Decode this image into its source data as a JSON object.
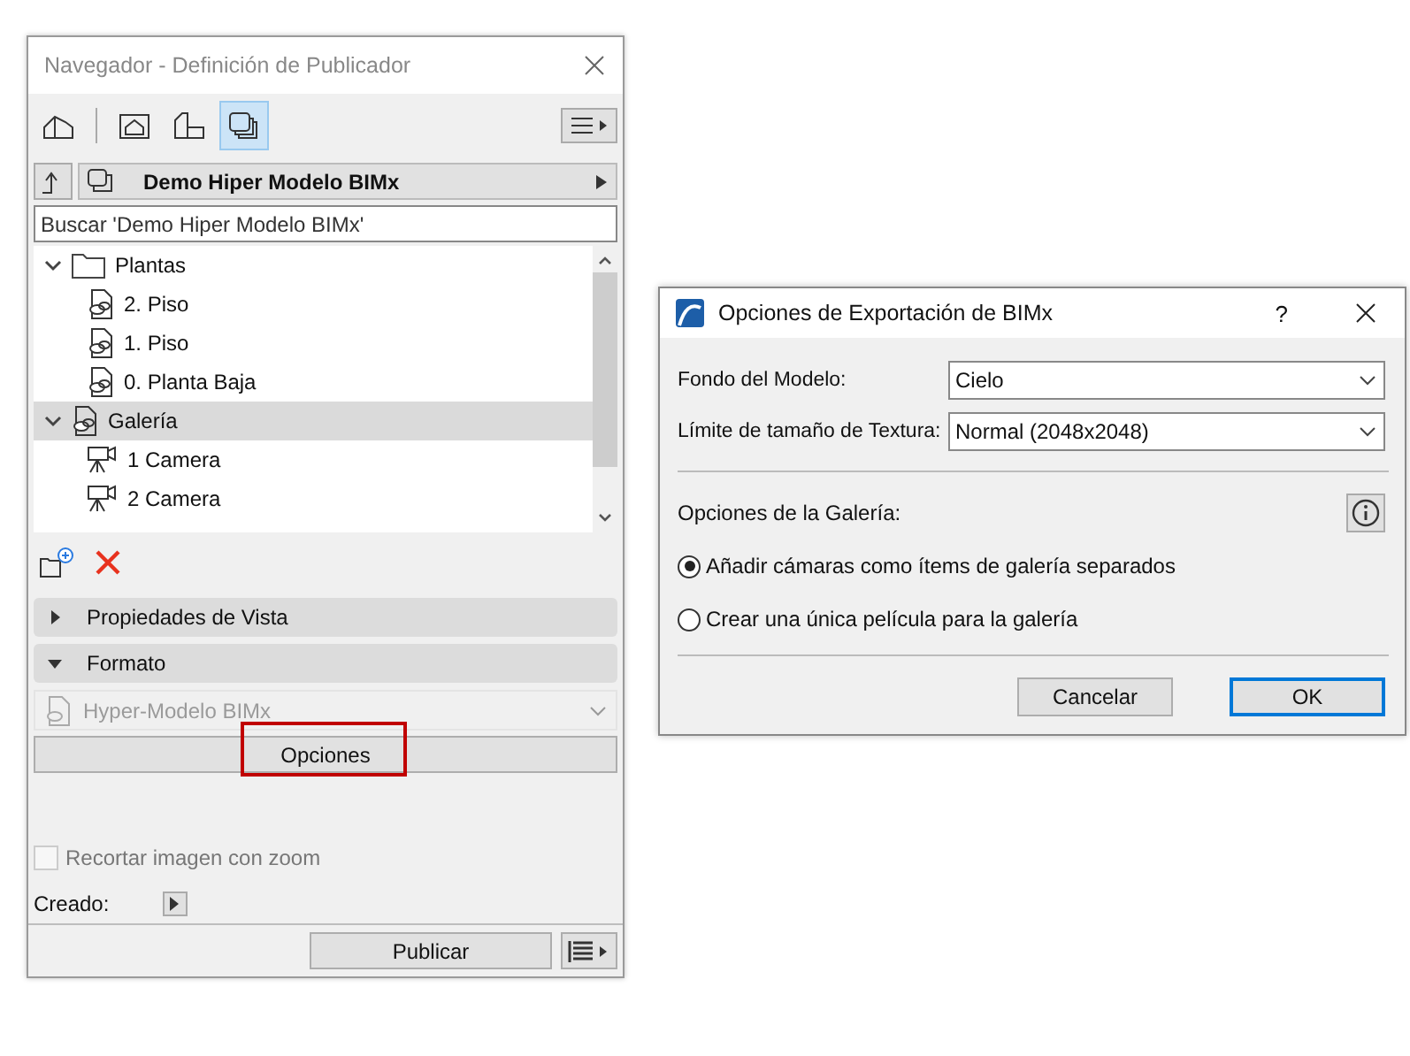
{
  "navigator": {
    "title": "Navegador - Definición de Publicador",
    "view_buttons": [
      {
        "selected": false
      },
      {
        "selected": false
      },
      {
        "selected": false
      },
      {
        "selected": true
      }
    ],
    "set_name": "Demo Hiper Modelo BIMx",
    "search": {
      "placeholder": "Buscar 'Demo Hiper Modelo BIMx'"
    },
    "tree": [
      {
        "label": "Plantas",
        "kind": "folder",
        "expanded": true,
        "selected": false,
        "children": [
          {
            "label": "2. Piso",
            "kind": "view",
            "selected": false
          },
          {
            "label": "1. Piso",
            "kind": "view",
            "selected": false
          },
          {
            "label": "0. Planta Baja",
            "kind": "view",
            "selected": false
          }
        ]
      },
      {
        "label": "Galería",
        "kind": "gallery",
        "expanded": true,
        "selected": true,
        "children": [
          {
            "label": "1 Camera",
            "kind": "camera",
            "selected": false
          },
          {
            "label": "2 Camera",
            "kind": "camera",
            "selected": false
          }
        ]
      }
    ],
    "sections": [
      {
        "label": "Propiedades de Vista",
        "expanded": false
      },
      {
        "label": "Formato",
        "expanded": true
      }
    ],
    "format": {
      "value": "Hyper-Modelo BIMx",
      "disabled": true
    },
    "options_button": "Opciones",
    "crop_checkbox": {
      "label": "Recortar imagen con zoom",
      "checked": false,
      "disabled": true
    },
    "created_label": "Creado:",
    "publish_button": "Publicar"
  },
  "dialog": {
    "title": "Opciones de Exportación de BIMx",
    "help": "?",
    "fields": [
      {
        "label": "Fondo del Modelo:",
        "value": "Cielo"
      },
      {
        "label": "Límite de tamaño de Textura:",
        "value": "Normal (2048x2048)"
      }
    ],
    "gallery_label": "Opciones de la Galería:",
    "radios": [
      {
        "label": "Añadir cámaras como ítems de galería separados",
        "selected": true
      },
      {
        "label": "Crear una única película para la galería",
        "selected": false
      }
    ],
    "buttons": [
      {
        "label": "Cancelar",
        "default": false
      },
      {
        "label": "OK",
        "default": true
      }
    ]
  }
}
